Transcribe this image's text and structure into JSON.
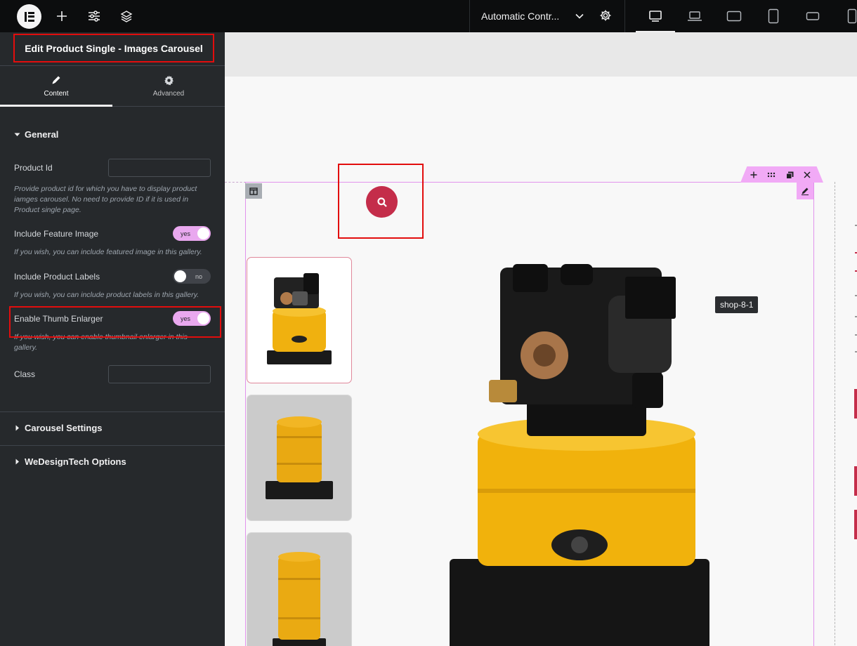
{
  "topbar": {
    "page_name": "Automatic Contr...",
    "icons": [
      "elementor-logo-icon",
      "add-icon",
      "settings-sliders-icon",
      "layers-icon",
      "chevron-down-icon",
      "gear-icon",
      "desktop-icon",
      "laptop-icon",
      "tablet-landscape-icon",
      "tablet-portrait-icon",
      "mobile-landscape-icon",
      "mobile-portrait-icon"
    ]
  },
  "panel": {
    "title": "Edit Product Single - Images Carousel",
    "tabs": [
      {
        "label": "Content",
        "icon": "pencil-icon"
      },
      {
        "label": "Advanced",
        "icon": "gear-icon"
      }
    ],
    "general": {
      "heading": "General",
      "product_id_label": "Product Id",
      "product_id_value": "",
      "product_id_desc": "Provide product id for which you have to display product iamges carousel. No need to provide ID if it is used in Product single page.",
      "feature_image_label": "Include Feature Image",
      "feature_image_state": "yes",
      "feature_image_desc": "If you wish, you can include featured image in this gallery.",
      "product_labels_label": "Include Product Labels",
      "product_labels_state": "no",
      "product_labels_desc": "If you wish, you can include product labels in this gallery.",
      "thumb_enlarger_label": "Enable Thumb Enlarger",
      "thumb_enlarger_state": "yes",
      "thumb_enlarger_desc": "If you wish, you can enable thumbnail enlarger in this gallery.",
      "class_label": "Class",
      "class_value": ""
    },
    "sections": [
      "Carousel Settings",
      "WeDesignTech Options"
    ]
  },
  "canvas": {
    "tooltip": "shop-8-1",
    "thumbnails": 3,
    "colors": {
      "accent": "#c42d4a",
      "pump_yellow": "#f1b20c",
      "editor_pink": "#f1aaf6",
      "highlight_red": "#e20d0d"
    }
  }
}
